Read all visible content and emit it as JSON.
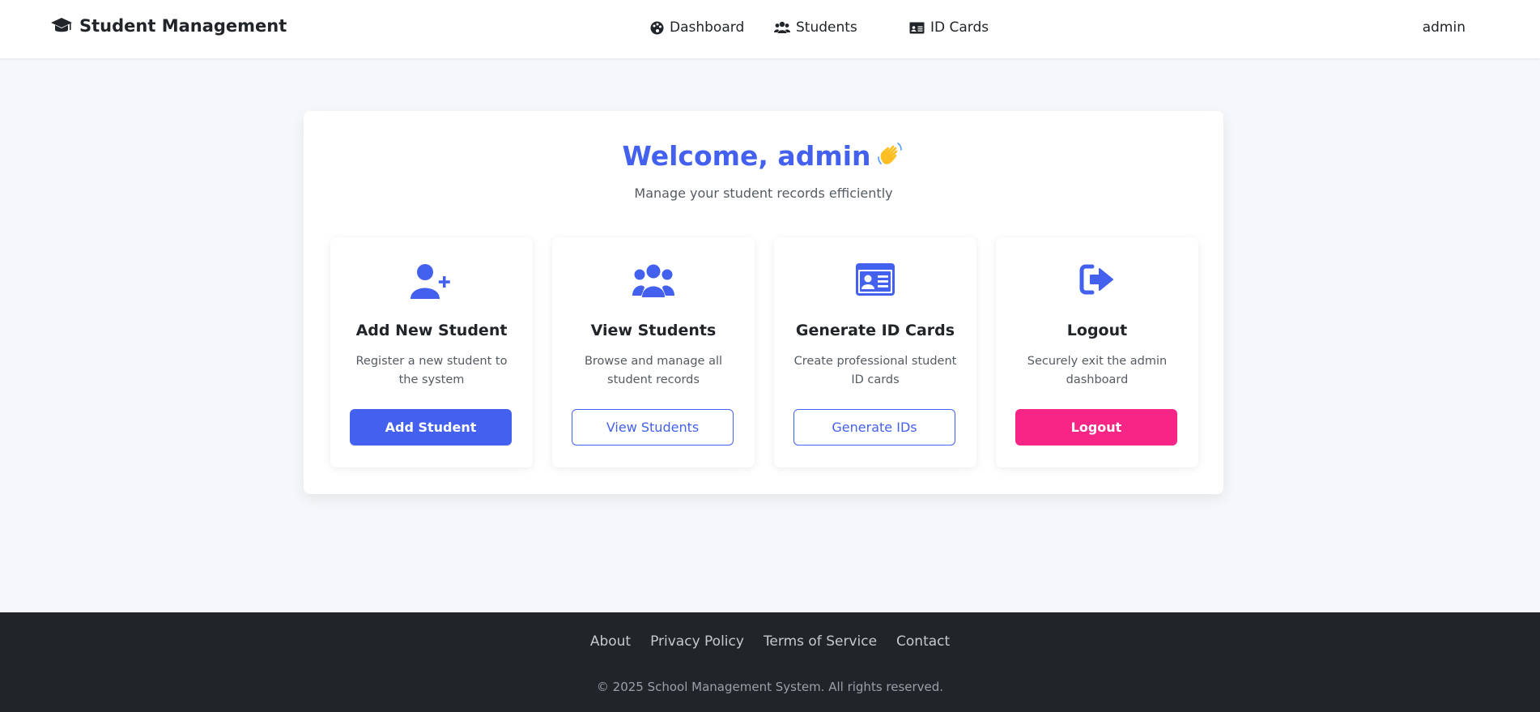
{
  "navbar": {
    "brand": "Student Management",
    "brand_icon": "graduation-cap-icon",
    "links": [
      {
        "label": "Dashboard",
        "icon": "palette-icon"
      },
      {
        "label": "Students",
        "icon": "users-icon"
      },
      {
        "label": "ID Cards",
        "icon": "id-card-icon"
      }
    ],
    "user": "admin"
  },
  "main": {
    "welcome": "Welcome, admin",
    "subtitle": "Manage your student records efficiently",
    "cards": [
      {
        "icon": "user-plus-icon",
        "title": "Add New Student",
        "description": "Register a new student to the system",
        "button": "Add Student"
      },
      {
        "icon": "users-icon",
        "title": "View Students",
        "description": "Browse and manage all student records",
        "button": "View Students"
      },
      {
        "icon": "id-card-icon",
        "title": "Generate ID Cards",
        "description": "Create professional student ID cards",
        "button": "Generate IDs"
      },
      {
        "icon": "sign-out-icon",
        "title": "Logout",
        "description": "Securely exit the admin dashboard",
        "button": "Logout"
      }
    ]
  },
  "footer": {
    "links": [
      "About",
      "Privacy Policy",
      "Terms of Service",
      "Contact"
    ],
    "copyright": "© 2025 School Management System. All rights reserved."
  },
  "colors": {
    "primary": "#4361ee",
    "danger": "#f72585",
    "footer_bg": "#212529",
    "page_bg": "#f5f7fa"
  }
}
